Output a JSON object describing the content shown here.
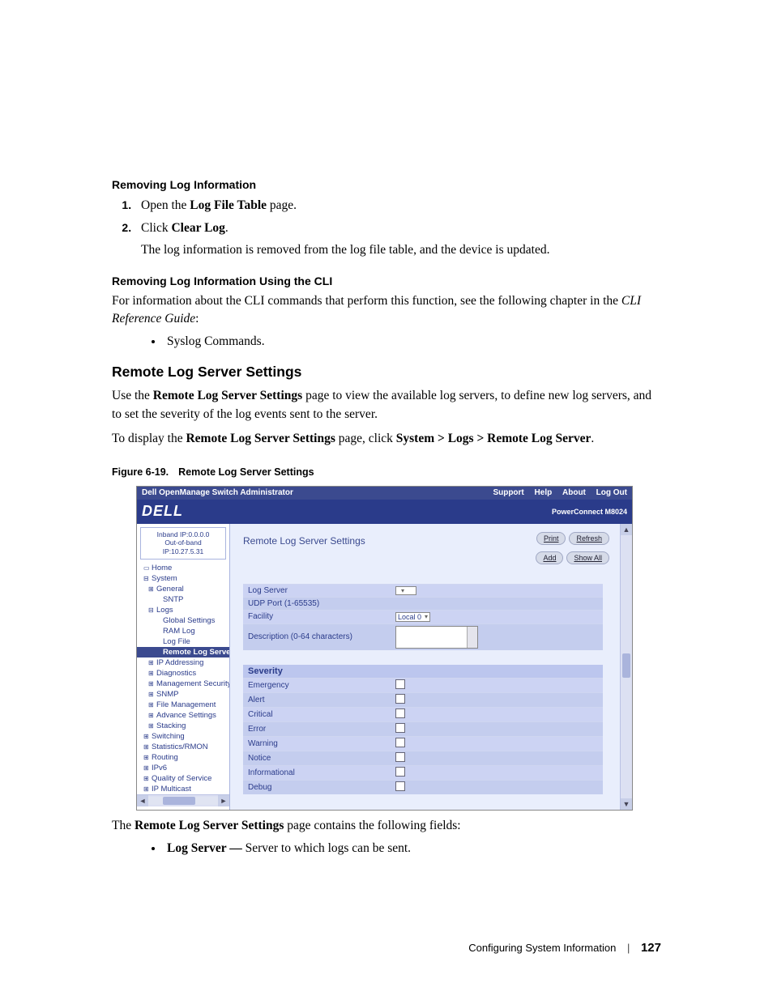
{
  "headings": {
    "removing": "Removing Log Information",
    "removing_cli": "Removing Log Information Using the CLI",
    "section": "Remote Log Server Settings",
    "figure": "Figure 6-19.",
    "figure_title": "Remote Log Server Settings"
  },
  "steps": [
    {
      "pre": "Open the ",
      "bold": "Log File Table",
      "post": " page."
    },
    {
      "pre": "Click ",
      "bold": "Clear Log",
      "post": "."
    }
  ],
  "after_steps": "The log information is removed from the log file table, and the device is updated.",
  "cli_intro_pre": "For information about the CLI commands that perform this function, see the following chapter in the ",
  "cli_intro_italic": "CLI Reference Guide",
  "cli_intro_post": ":",
  "cli_bullet": "Syslog Commands.",
  "section_intro_pre": "Use the ",
  "section_intro_bold": "Remote Log Server Settings",
  "section_intro_post": " page to view the available log servers, to define new log servers, and to set the severity of the log events sent to the server.",
  "section_path_pre": "To display the ",
  "section_path_bold": "Remote Log Server Settings",
  "section_path_mid": " page, click ",
  "section_path_path": "System > Logs > Remote Log Server",
  "section_path_post": ".",
  "below_fig_pre": "The ",
  "below_fig_bold": "Remote Log Server Settings",
  "below_fig_post": " page contains the following fields:",
  "field_bullet_bold": "Log Server — ",
  "field_bullet_rest": "Server to which logs can be sent.",
  "footer": {
    "chapter": "Configuring System Information",
    "page": "127"
  },
  "screenshot": {
    "topbar_left": "Dell OpenManage Switch Administrator",
    "topbar_links": [
      "Support",
      "Help",
      "About",
      "Log Out"
    ],
    "brand": "DELL",
    "model": "PowerConnect M8024",
    "ip1": "Inband IP:0.0.0.0",
    "ip2": "Out-of-band IP:10.27.5.31",
    "nav": [
      {
        "l": 1,
        "exp": "▭",
        "t": "Home"
      },
      {
        "l": 1,
        "exp": "⊟",
        "t": "System"
      },
      {
        "l": 2,
        "exp": "⊞",
        "t": "General"
      },
      {
        "l": 3,
        "exp": "",
        "t": "SNTP"
      },
      {
        "l": 2,
        "exp": "⊟",
        "t": "Logs"
      },
      {
        "l": 3,
        "exp": "",
        "t": "Global Settings"
      },
      {
        "l": 3,
        "exp": "",
        "t": "RAM Log"
      },
      {
        "l": 3,
        "exp": "",
        "t": "Log File"
      },
      {
        "l": 3,
        "exp": "",
        "t": "Remote Log Server",
        "active": true
      },
      {
        "l": 2,
        "exp": "⊞",
        "t": "IP Addressing"
      },
      {
        "l": 2,
        "exp": "⊞",
        "t": "Diagnostics"
      },
      {
        "l": 2,
        "exp": "⊞",
        "t": "Management Security"
      },
      {
        "l": 2,
        "exp": "⊞",
        "t": "SNMP"
      },
      {
        "l": 2,
        "exp": "⊞",
        "t": "File Management"
      },
      {
        "l": 2,
        "exp": "⊞",
        "t": "Advance Settings"
      },
      {
        "l": 2,
        "exp": "⊞",
        "t": "Stacking"
      },
      {
        "l": 1,
        "exp": "⊞",
        "t": "Switching"
      },
      {
        "l": 1,
        "exp": "⊞",
        "t": "Statistics/RMON"
      },
      {
        "l": 1,
        "exp": "⊞",
        "t": "Routing"
      },
      {
        "l": 1,
        "exp": "⊞",
        "t": "IPv6"
      },
      {
        "l": 1,
        "exp": "⊞",
        "t": "Quality of Service"
      },
      {
        "l": 1,
        "exp": "⊞",
        "t": "IP Multicast"
      }
    ],
    "main_title": "Remote Log Server Settings",
    "buttons1": [
      "Print",
      "Refresh"
    ],
    "buttons2": [
      "Add",
      "Show All"
    ],
    "form": [
      {
        "label": "Log Server",
        "ctrl": "select",
        "val": ""
      },
      {
        "label": "UDP Port (1-65535)",
        "ctrl": "text",
        "val": ""
      },
      {
        "label": "Facility",
        "ctrl": "select",
        "val": "Local 0"
      },
      {
        "label": "Description (0-64 characters)",
        "ctrl": "textarea",
        "val": ""
      }
    ],
    "severity_header": "Severity",
    "severity": [
      "Emergency",
      "Alert",
      "Critical",
      "Error",
      "Warning",
      "Notice",
      "Informational",
      "Debug"
    ]
  }
}
